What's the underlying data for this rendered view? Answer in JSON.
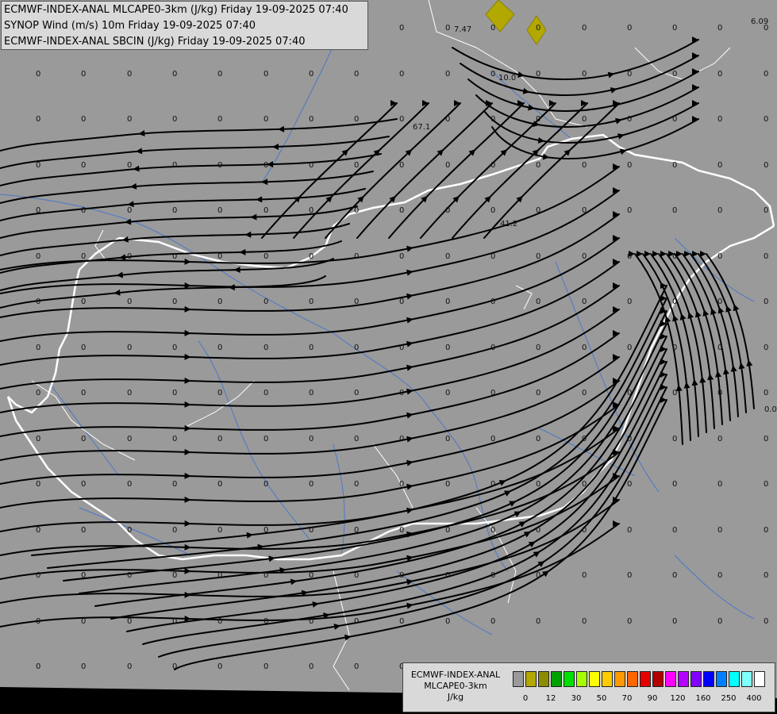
{
  "titles": [
    "ECMWF-INDEX-ANAL MLCAPE0-3km (J/kg) Friday 19-09-2025 07:40",
    "SYNOP Wind (m/s) 10m Friday 19-09-2025 07:40",
    "ECMWF-INDEX-ANAL SBCIN (J/kg) Friday 19-09-2025 07:40"
  ],
  "legend": {
    "line1": "ECMWF-INDEX-ANAL",
    "line2": "MLCAPE0-3km",
    "unit": "J/kg",
    "colors": [
      "#9a9a9a",
      "#b3a800",
      "#8c8c00",
      "#00a000",
      "#00e000",
      "#a8ff00",
      "#ffff00",
      "#ffcc00",
      "#ff9900",
      "#ff6600",
      "#e60000",
      "#b30000",
      "#ff00ff",
      "#b300ff",
      "#8000ff",
      "#0000ff",
      "#0080ff",
      "#00ffff",
      "#80ffff",
      "#ffffff"
    ],
    "ticks": [
      "0",
      "12",
      "30",
      "50",
      "70",
      "90",
      "120",
      "160",
      "250",
      "400"
    ]
  },
  "labels": [
    {
      "t": "7.47"
    },
    {
      "t": "6.09"
    },
    {
      "t": "10.0"
    },
    {
      "t": "67.1"
    },
    {
      "t": "41.2"
    },
    {
      "t": "0.0"
    }
  ],
  "zero_value": "0"
}
